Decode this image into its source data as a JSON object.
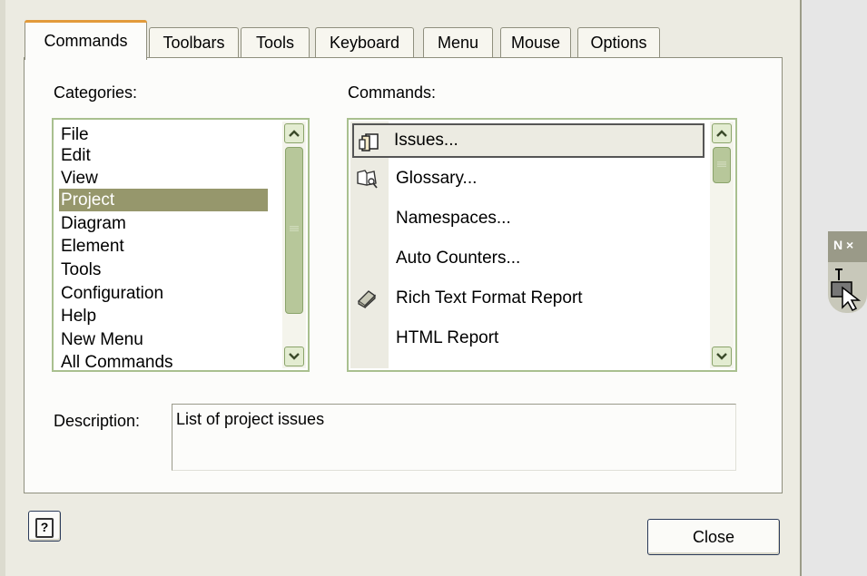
{
  "tabs": [
    {
      "label": "Commands",
      "active": true
    },
    {
      "label": "Toolbars",
      "active": false
    },
    {
      "label": "Tools",
      "active": false
    },
    {
      "label": "Keyboard",
      "active": false
    },
    {
      "label": "Menu",
      "active": false
    },
    {
      "label": "Mouse",
      "active": false
    },
    {
      "label": "Options",
      "active": false
    }
  ],
  "categories": {
    "label": "Categories:",
    "selected": "Project",
    "items": [
      "File",
      "Edit",
      "View",
      "Project",
      "Diagram",
      "Element",
      "Tools",
      "Configuration",
      "Help",
      "New Menu",
      "All Commands"
    ]
  },
  "commands": {
    "label": "Commands:",
    "focused": "Issues...",
    "items": [
      {
        "label": "Issues...",
        "icon": "issues-icon"
      },
      {
        "label": "Glossary...",
        "icon": "glossary-icon"
      },
      {
        "label": "Namespaces...",
        "icon": null
      },
      {
        "label": "Auto Counters...",
        "icon": null
      },
      {
        "label": "Rich Text Format Report",
        "icon": "rtf-report-icon"
      },
      {
        "label": "HTML Report",
        "icon": null
      }
    ]
  },
  "description": {
    "label": "Description:",
    "value": "List of project issues"
  },
  "buttons": {
    "help": "?",
    "close": "Close"
  },
  "floating_toolbar": {
    "title": "N ×"
  },
  "colors": {
    "accent_tab": "#e29a3a",
    "selection": "#96976c",
    "listbox_border": "#a9c08f",
    "dialog_bg": "#ecebe2"
  }
}
